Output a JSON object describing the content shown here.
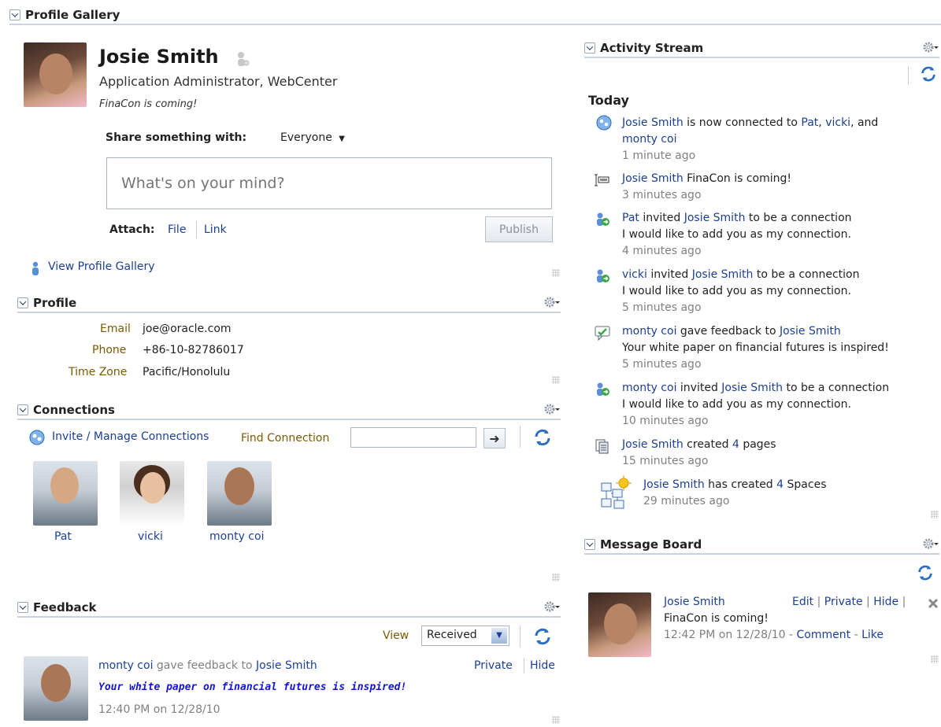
{
  "gallery": {
    "title": "Profile Gallery"
  },
  "profile_card": {
    "name": "Josie Smith",
    "job_title": "Application Administrator, WebCenter",
    "status": "FinaCon is coming!",
    "share_label": "Share something with:",
    "share_target": "Everyone",
    "placeholder": "What's on your mind?",
    "attach_label": "Attach:",
    "attach_file": "File",
    "attach_link": "Link",
    "publish": "Publish",
    "view_gallery": "View Profile Gallery"
  },
  "profile": {
    "title": "Profile",
    "fields": [
      {
        "label": "Email",
        "value": "joe@oracle.com"
      },
      {
        "label": "Phone",
        "value": "+86-10-82786017"
      },
      {
        "label": "Time Zone",
        "value": "Pacific/Honolulu"
      }
    ]
  },
  "connections": {
    "title": "Connections",
    "invite": "Invite / Manage Connections",
    "find_label": "Find Connection",
    "people": [
      "Pat",
      "vicki",
      "monty coi"
    ]
  },
  "feedback": {
    "title": "Feedback",
    "view_label": "View",
    "view_value": "Received",
    "item": {
      "from": "monty coi",
      "verb": "gave feedback to",
      "to": "Josie Smith",
      "private": "Private",
      "hide": "Hide",
      "message": "Your white paper on financial futures is inspired!",
      "time": "12:40 PM on 12/28/10"
    }
  },
  "activity": {
    "title": "Activity Stream",
    "day": "Today",
    "items": [
      {
        "icon": "connections-icon",
        "a": "Josie Smith",
        "t1": " is now connected to ",
        "b": "Pat",
        "t2": ", ",
        "c": "vicki",
        "t3": ", and",
        "d": "monty coi",
        "time": "1 minute ago"
      },
      {
        "icon": "status-icon",
        "a": "Josie Smith",
        "t1": " FinaCon is coming!",
        "time": "3 minutes ago"
      },
      {
        "icon": "invite-icon",
        "a": "Pat",
        "t1": " invited ",
        "b": "Josie Smith",
        "t2": " to be a connection",
        "msg": "I would like to add you as my connection.",
        "time": "4 minutes ago"
      },
      {
        "icon": "invite-icon",
        "a": "vicki",
        "t1": " invited ",
        "b": "Josie Smith",
        "t2": " to be a connection",
        "msg": "I would like to add you as my connection.",
        "time": "5 minutes ago"
      },
      {
        "icon": "feedback-icon",
        "a": "monty coi",
        "t1": " gave feedback to ",
        "b": "Josie Smith",
        "msg": "Your white paper on financial futures is inspired!",
        "time": "5 minutes ago"
      },
      {
        "icon": "invite-icon",
        "a": "monty coi",
        "t1": " invited ",
        "b": "Josie Smith",
        "t2": " to be a connection",
        "msg": "I would like to add you as my connection.",
        "time": "10 minutes ago"
      },
      {
        "icon": "pages-icon",
        "a": "Josie Smith",
        "t1": " created ",
        "b": "4",
        "t2": " pages",
        "time": "15 minutes ago"
      },
      {
        "icon": "spaces-icon",
        "a": "Josie Smith",
        "t1": " has created ",
        "b": "4",
        "t2": " Spaces",
        "time": "29 minutes ago"
      }
    ]
  },
  "message_board": {
    "title": "Message Board",
    "author": "Josie Smith",
    "edit": "Edit",
    "private": "Private",
    "hide": "Hide",
    "text": "FinaCon is coming!",
    "time": "12:42 PM on 12/28/10",
    "comment": "Comment",
    "like": "Like"
  }
}
